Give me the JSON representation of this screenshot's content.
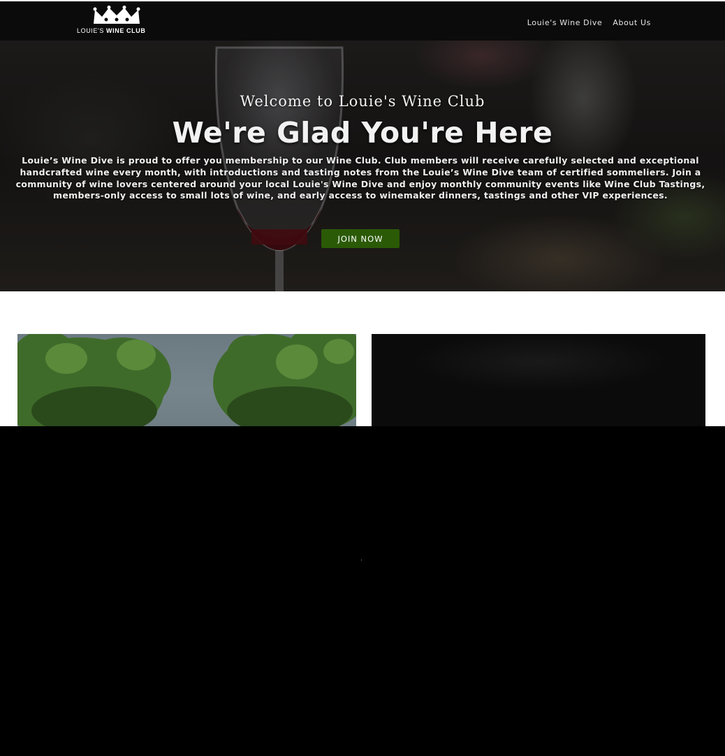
{
  "header": {
    "logo": {
      "text_light": "LOUIE'S ",
      "text_bold": "WINE CLUB"
    },
    "nav": [
      {
        "label": "Louie's Wine Dive"
      },
      {
        "label": "About Us"
      }
    ]
  },
  "hero": {
    "subtitle": "Welcome to Louie's Wine Club",
    "title": "We're Glad You're Here",
    "description": "Louie’s Wine Dive is proud to offer you membership to our Wine Club. Club members will receive carefully selected and exceptional handcrafted wine every month, with introductions and tasting notes from the Louie’s Wine Dive team of certified sommeliers. Join a community of wine lovers centered around your local Louie's Wine Dive and enjoy monthly community events like Wine Club Tastings, members-only access to small lots of wine, and early access to winemaker dinners, tastings and other VIP experiences.",
    "cta_label": "JOIN NOW"
  },
  "colors": {
    "cta_green": "#2b5a06",
    "header_bg": "#0a0a0a",
    "overlay": "#000000"
  },
  "icons": {
    "logo_mark": "crown-icon"
  }
}
